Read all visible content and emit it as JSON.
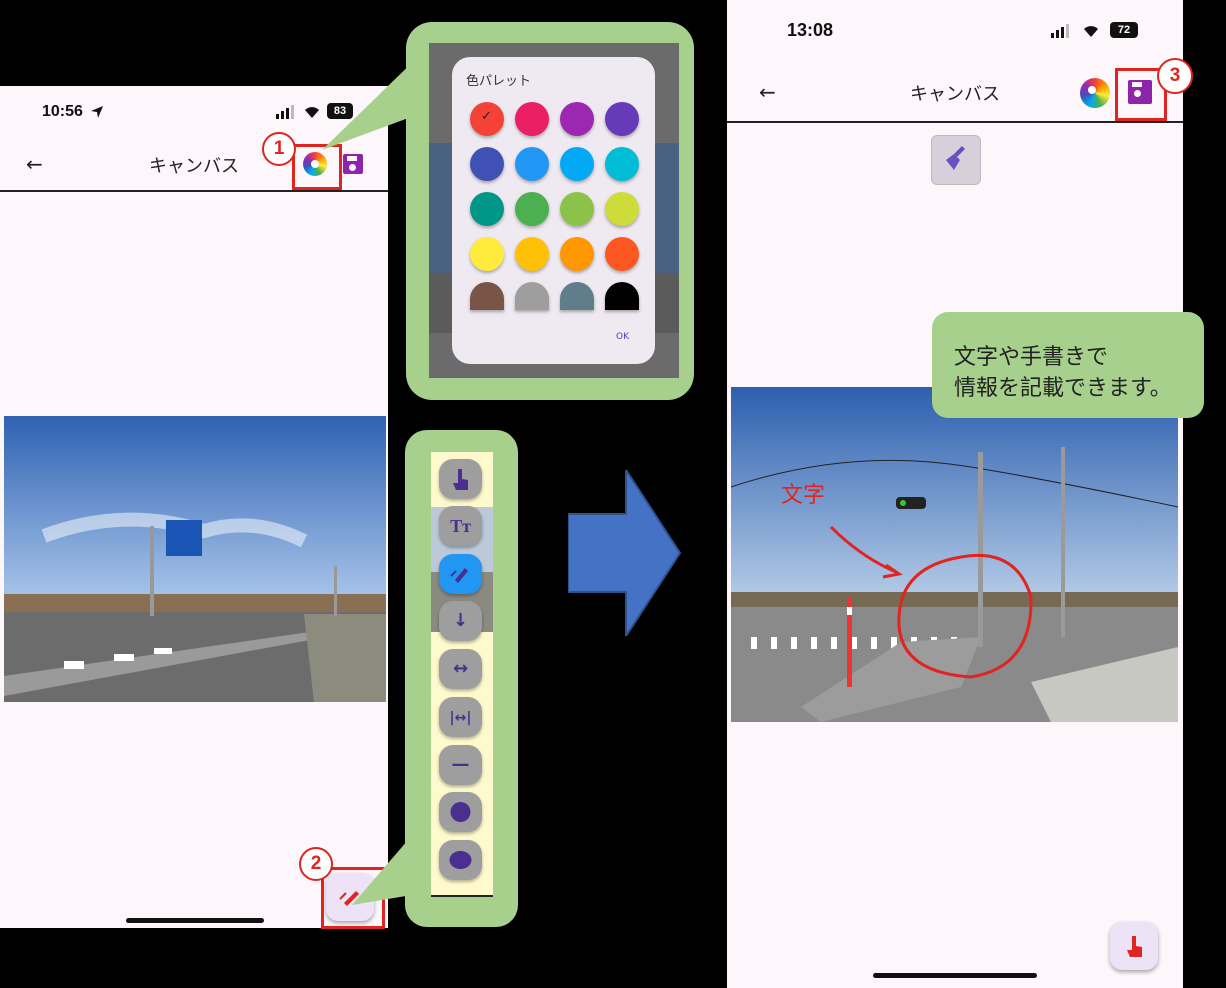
{
  "left_screen": {
    "time": "10:56",
    "battery": "83",
    "title": "キャンバス"
  },
  "right_screen": {
    "time": "13:08",
    "battery": "72",
    "title": "キャンバス"
  },
  "palette_dialog": {
    "title": "色パレット",
    "ok_label": "OK",
    "colors": [
      "#f44336",
      "#e91e63",
      "#9c27b0",
      "#673ab7",
      "#3f51b5",
      "#2196f3",
      "#03a9f4",
      "#00bcd4",
      "#009688",
      "#4caf50",
      "#8bc34a",
      "#cddc39",
      "#ffeb3b",
      "#ffc107",
      "#ff9800",
      "#ff5722",
      "#795548",
      "#9e9e9e",
      "#607d8b",
      "#000000"
    ],
    "selected": "#f44336"
  },
  "tools": [
    "pan-tool-icon",
    "text-tool-icon",
    "draw-tool-icon",
    "arrow-down-icon",
    "double-arrow-icon",
    "dimension-icon",
    "line-icon",
    "circle-fill-icon",
    "oval-fill-icon"
  ],
  "annotations": {
    "step1": "1",
    "step2": "2",
    "step3": "3",
    "callout_line1": "文字や手書きで",
    "callout_line2": "情報を記載できます。",
    "photo_text": "文字"
  },
  "colors": {
    "accent": "#8e24aa",
    "highlight": "#e0241f",
    "callout": "#a8d08d",
    "arrow": "#4472c4"
  }
}
